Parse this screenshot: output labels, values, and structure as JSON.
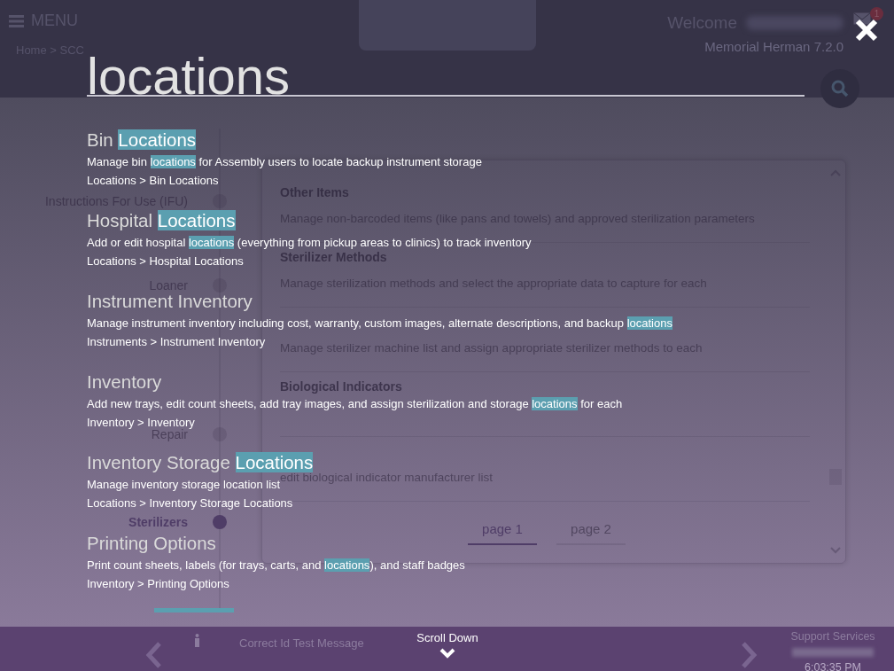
{
  "header": {
    "menu_label": "MENU",
    "breadcrumb": "Home > SCC",
    "welcome": "Welcome",
    "notification_count": "1",
    "version": "Memorial Herman 7.2.0"
  },
  "sidebar": {
    "items": [
      {
        "label": "Instructions For Use (IFU)",
        "selected": false
      },
      {
        "label": "Loaner",
        "selected": false
      },
      {
        "label": "Repair",
        "selected": false
      },
      {
        "label": "Sterilizers",
        "selected": true
      }
    ]
  },
  "panel": {
    "items": [
      {
        "title": "Other Items",
        "description": "Manage non-barcoded items (like pans and towels) and approved sterilization parameters"
      },
      {
        "title": "Sterilizer Methods",
        "description": "Manage sterilization methods and select the appropriate data to capture for each"
      },
      {
        "description": "Manage sterilizer machine list and assign appropriate sterilizer methods to each"
      },
      {
        "title": "Biological Indicators"
      },
      {
        "description": "edit biological indicator manufacturer list"
      }
    ],
    "pages": [
      {
        "label": "page 1",
        "selected": true
      },
      {
        "label": "page 2",
        "selected": false
      }
    ]
  },
  "search": {
    "value": "locations",
    "results": [
      {
        "title": [
          {
            "text": "Bin ",
            "highlight": false
          },
          {
            "text": "Locations",
            "highlight": true
          }
        ],
        "description": [
          {
            "text": "Manage bin ",
            "highlight": false
          },
          {
            "text": "locations",
            "highlight": true
          },
          {
            "text": " for Assembly users to locate backup instrument storage",
            "highlight": false
          }
        ],
        "path": "Locations > Bin Locations"
      },
      {
        "title": [
          {
            "text": "Hospital ",
            "highlight": false
          },
          {
            "text": "Locations",
            "highlight": true
          }
        ],
        "description": [
          {
            "text": "Add or edit hospital ",
            "highlight": false
          },
          {
            "text": "locations",
            "highlight": true
          },
          {
            "text": " (everything from pickup areas to clinics) to track inventory",
            "highlight": false
          }
        ],
        "path": "Locations > Hospital Locations"
      },
      {
        "title": [
          {
            "text": "Instrument Inventory",
            "highlight": false
          }
        ],
        "description": [
          {
            "text": "Manage instrument inventory including cost, warranty, custom images, alternate descriptions, and backup ",
            "highlight": false
          },
          {
            "text": "locations",
            "highlight": true
          }
        ],
        "path": "Instruments > Instrument Inventory"
      },
      {
        "title": [
          {
            "text": "Inventory",
            "highlight": false
          }
        ],
        "description": [
          {
            "text": "Add new trays, edit count sheets, add tray images, and assign sterilization and storage ",
            "highlight": false
          },
          {
            "text": "locations",
            "highlight": true
          },
          {
            "text": " for each",
            "highlight": false
          }
        ],
        "path": "Inventory > Inventory"
      },
      {
        "title": [
          {
            "text": "Inventory Storage ",
            "highlight": false
          },
          {
            "text": "Locations",
            "highlight": true
          }
        ],
        "description": [
          {
            "text": "Manage inventory storage location list",
            "highlight": false
          }
        ],
        "path": "Locations > Inventory Storage Locations"
      },
      {
        "title": [
          {
            "text": "Printing Options",
            "highlight": false
          }
        ],
        "description": [
          {
            "text": "Print count sheets, labels (for trays, carts, and ",
            "highlight": false
          },
          {
            "text": "locations",
            "highlight": true
          },
          {
            "text": "), and staff badges",
            "highlight": false
          }
        ],
        "path": "Inventory > Printing Options"
      }
    ]
  },
  "footer": {
    "message": "Correct Id Test Message",
    "scroll_label": "Scroll Down",
    "support_label": "Support Services",
    "time": "6:03:35 PM"
  }
}
